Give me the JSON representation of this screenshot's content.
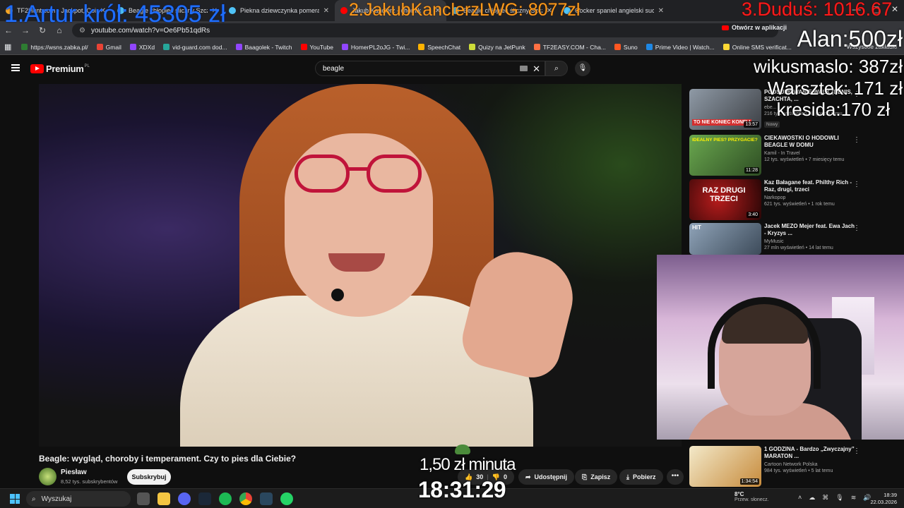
{
  "browser": {
    "tabs": [
      {
        "title": "TF2Hunt.com - Jackpot, Coinflip",
        "active": false
      },
      {
        "title": "Beagle chłopiec śliczny Szczecin",
        "active": false
      },
      {
        "title": "Piekna dziewczynka pomerania",
        "active": false
      },
      {
        "title": "Jakub Kanclerz - chomik",
        "active": true
      },
      {
        "title": "Beagle chłopiec śliczny Szczecin",
        "active": false
      },
      {
        "title": "Cocker spaniel angielski suczka",
        "active": false
      }
    ],
    "url": "youtube.com/watch?v=Oe6Pb51qdRs",
    "open_in_app": "Otwórz w aplikacji",
    "bookmarks": [
      {
        "label": "https://wsns.zabka.pl/",
        "color": "#2e7d32"
      },
      {
        "label": "Gmail",
        "color": "#ea4335"
      },
      {
        "label": "XDXd",
        "color": "#9146ff"
      },
      {
        "label": "vid-guard.com dod...",
        "color": "#26a69a"
      },
      {
        "label": "Baagolek - Twitch",
        "color": "#9146ff"
      },
      {
        "label": "YouTube",
        "color": "#ff0000"
      },
      {
        "label": "HomerPL2oJG - Twi...",
        "color": "#9146ff"
      },
      {
        "label": "SpeechChat",
        "color": "#ffb300"
      },
      {
        "label": "Quizy na JetPunk",
        "color": "#cddc39"
      },
      {
        "label": "TF2EASY.COM - Cha...",
        "color": "#ff7043"
      },
      {
        "label": "Suno",
        "color": "#ff5722"
      },
      {
        "label": "Prime Video | Watch...",
        "color": "#1e88e5"
      },
      {
        "label": "Online SMS verificat...",
        "color": "#fdd835"
      }
    ],
    "all_bookmarks": "Wszystkie zakładki"
  },
  "youtube": {
    "logo_word": "Premium",
    "logo_region": "PL",
    "search_value": "beagle",
    "video": {
      "title": "Beagle: wygląd, choroby i temperament. Czy to pies dla Ciebie?",
      "channel": "Piesław",
      "subscribers": "8,52 tys. subskrybentów",
      "subscribe_label": "Subskrybuj",
      "likes": "30",
      "dislikes": "0",
      "share_label": "Udostępnij",
      "save_label": "Zapisz",
      "download_label": "Pobierz"
    },
    "suggestions": [
      {
        "title": "PODSUMOWANIE WALK (DENIS, SZACHTA, ...",
        "channel": "ebe...",
        "views": "216 tys. wyświetleń • 8 godzin temu",
        "duration": "13:57",
        "badge": "Nowy",
        "thumb_text": "TO NIE KONIEC KONFLI"
      },
      {
        "title": "CIEKAWOSTKI O HODOWLI BEAGLE W DOMU",
        "channel": "Kamil - In Travel",
        "views": "12 tys. wyświetleń • 7 miesięcy temu",
        "duration": "11:28",
        "badge": "",
        "thumb_text": "IDEALNY PIES? PRZYGACIE?"
      },
      {
        "title": "Kaz Bałagane feat. Philthy Rich - Raz, drugi, trzeci",
        "channel": "Narkopop",
        "views": "621 tys. wyświetleń • 1 rok temu",
        "duration": "3:40",
        "badge": "",
        "thumb_text": "RAZ DRUGI TRZECI"
      },
      {
        "title": "Jacek MEZO Mejer feat. Ewa Jach - Kryzys ...",
        "channel": "MyMusic",
        "views": "27 mln wyświetleń • 14 lat temu",
        "duration": "",
        "badge": "",
        "thumb_text": "HIT"
      },
      {
        "title": "1 GODZINA - Bardzo „Zwyczajny” MARATON ...",
        "channel": "Cartoon Network Polska",
        "views": "984 tys. wyświetleń • 5 lat temu",
        "duration": "1:34:54",
        "badge": "",
        "thumb_text": ""
      }
    ]
  },
  "overlay": {
    "rank1": "1.Artur król: 45305 zł",
    "rank2": "2.JakubKanclerzLWG: 8077zł",
    "rank3": "3.Duduś: 1016.67",
    "donor1": "Alan:500zł",
    "donor2": "wikusmaslo: 387zł",
    "donor3": "Warsztek: 171 zł",
    "donor4": "kresida:170 zł",
    "rate": "1,50 zł minuta",
    "timer": "18:31:29"
  },
  "taskbar": {
    "search_placeholder": "Wyszukaj",
    "weather_temp": "8°C",
    "weather_cond": "Przew. słonecz.",
    "time": "18:39",
    "date": "22.03.2026"
  },
  "colors": {
    "yt_red": "#ff0000",
    "overlay_rank1": "#1f6fff",
    "overlay_rank2": "#ff9a1a",
    "overlay_rank3": "#ff1a1a"
  }
}
